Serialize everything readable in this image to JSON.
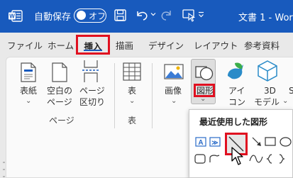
{
  "titlebar": {
    "autosave_label": "自動保存",
    "autosave_state": "オフ",
    "doc_title": "文書 1 - Word"
  },
  "tabs": [
    {
      "label": "ファイル"
    },
    {
      "label": "ホーム"
    },
    {
      "label": "挿入"
    },
    {
      "label": "描画"
    },
    {
      "label": "デザイン"
    },
    {
      "label": "レイアウト"
    },
    {
      "label": "参考資料"
    }
  ],
  "ribbon": {
    "pages_group": {
      "cover_l1": "表紙",
      "blank_l1": "空白の",
      "blank_l2": "ページ",
      "break_l1": "ページ",
      "break_l2": "区切り",
      "group_label": "ページ"
    },
    "table_group": {
      "table_label": "表",
      "group_label": "表"
    },
    "illus_group": {
      "image_label": "画像",
      "shapes_label": "図形",
      "icons_l1": "アイ",
      "icons_l2": "コン",
      "model_l1": "3D",
      "model_l2": "モデル",
      "smartart_partial": "S"
    }
  },
  "shapes_menu": {
    "recent_heading": "最近使用した図形"
  },
  "colors": {
    "titlebar": "#185abd",
    "highlight": "#e01020"
  }
}
